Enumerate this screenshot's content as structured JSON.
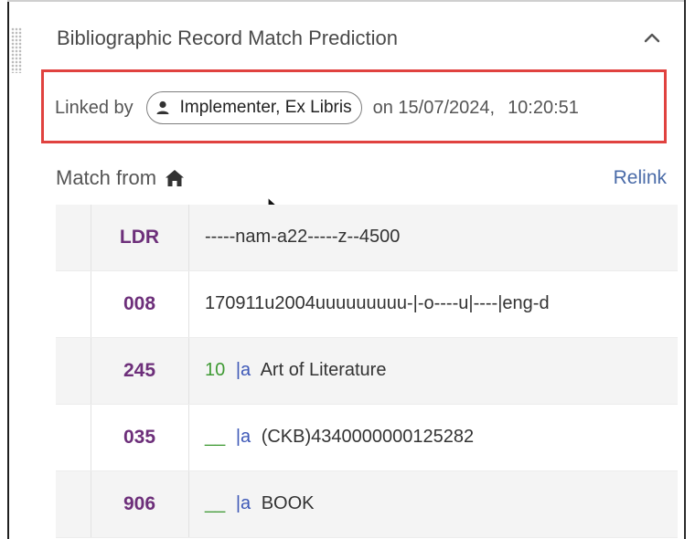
{
  "panel": {
    "title": "Bibliographic Record Match Prediction",
    "linked": {
      "prefix": "Linked by",
      "user": "Implementer, Ex Libris",
      "date_text": "on 15/07/2024,",
      "time_text": "10:20:51"
    },
    "match_from_label": "Match from",
    "relink_label": "Relink"
  },
  "records": [
    {
      "tag": "LDR",
      "indicators": "",
      "subfield": "",
      "value": "-----nam-a22-----z--4500"
    },
    {
      "tag": "008",
      "indicators": "",
      "subfield": "",
      "value": "170911u2004uuuuuuuuu-|-o----u|----|eng-d"
    },
    {
      "tag": "245",
      "indicators": "10",
      "subfield": "|a",
      "value": "Art of Literature"
    },
    {
      "tag": "035",
      "indicators": "__",
      "subfield": "|a",
      "value": "(CKB)4340000000125282"
    },
    {
      "tag": "906",
      "indicators": "__",
      "subfield": "|a",
      "value": "BOOK"
    }
  ],
  "colors": {
    "highlight_border": "#e0423f",
    "tag": "#6d2f7a",
    "indicator": "#3f9a34",
    "subfield": "#3d58b7",
    "link": "#4a6ba8"
  },
  "icons": {
    "drag": "drag-handle-icon",
    "collapse": "chevron-up-icon",
    "user": "person-icon",
    "home": "home-icon",
    "pointer": "mouse-pointer-icon"
  }
}
